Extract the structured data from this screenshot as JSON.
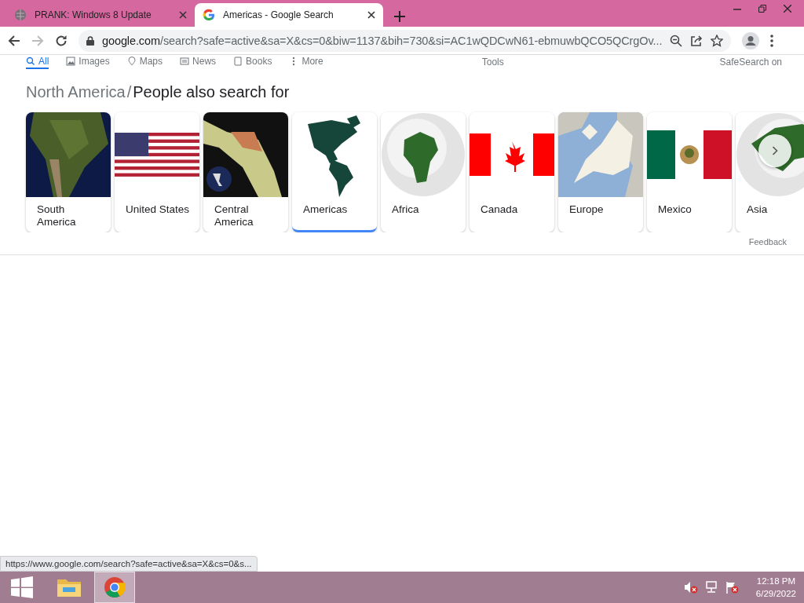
{
  "browser_tabs": [
    {
      "title": "PRANK: Windows 8 Update",
      "kind": "globe",
      "selected": false
    },
    {
      "title": "Americas - Google Search",
      "kind": "google",
      "selected": true
    }
  ],
  "address_bar": {
    "host": "google.com",
    "path": "/search?safe=active&sa=X&cs=0&biw=1137&bih=730&si=AC1wQDCwN61-ebmuwbQCO5QCrgOv..."
  },
  "nav_links": [
    {
      "label": "All",
      "selected": true
    },
    {
      "label": "Images",
      "selected": false
    },
    {
      "label": "Maps",
      "selected": false
    },
    {
      "label": "News",
      "selected": false
    },
    {
      "label": "Books",
      "selected": false
    },
    {
      "label": "More",
      "selected": false
    }
  ],
  "tools": "Tools",
  "safesearch": "SafeSearch on",
  "heading": {
    "parent": "North America",
    "separator": "/",
    "title": "People also search for"
  },
  "cards": [
    {
      "label": "South America",
      "selected": false
    },
    {
      "label": "United States",
      "selected": false
    },
    {
      "label": "Central America",
      "selected": false
    },
    {
      "label": "Americas",
      "selected": true
    },
    {
      "label": "Africa",
      "selected": false
    },
    {
      "label": "Canada",
      "selected": false
    },
    {
      "label": "Europe",
      "selected": false
    },
    {
      "label": "Mexico",
      "selected": false
    },
    {
      "label": "Asia",
      "selected": false
    }
  ],
  "feedback": "Feedback",
  "status_url": "https://www.google.com/search?safe=active&sa=X&cs=0&s...",
  "taskbar": {
    "apps": [
      {
        "kind": "folder",
        "selected": false
      },
      {
        "kind": "chrome",
        "selected": true
      }
    ],
    "time": "12:18 PM",
    "date": "6/29/2022"
  }
}
